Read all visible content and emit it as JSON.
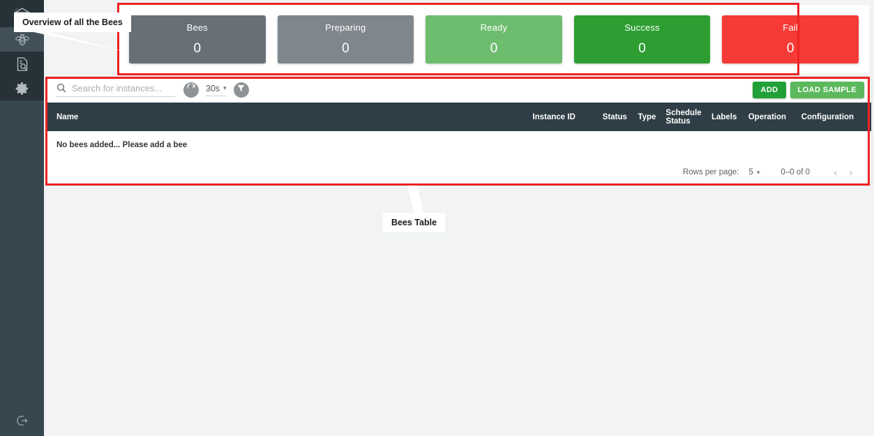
{
  "sidebar": {
    "items": [
      {
        "name": "beehive-icon",
        "label": "Beehive",
        "active": false
      },
      {
        "name": "bee-icon",
        "label": "Bees",
        "active": true
      },
      {
        "name": "document-search-icon",
        "label": "Logs",
        "active": false
      },
      {
        "name": "gear-icon",
        "label": "Settings",
        "active": false
      }
    ],
    "logout": {
      "name": "logout-icon",
      "label": "Logout"
    }
  },
  "cards": [
    {
      "label": "Bees",
      "value": "0",
      "color": "#687077"
    },
    {
      "label": "Preparing",
      "value": "0",
      "color": "#7f868c"
    },
    {
      "label": "Ready",
      "value": "0",
      "color": "#6ebd6f"
    },
    {
      "label": "Success",
      "value": "0",
      "color": "#2e9e33"
    },
    {
      "label": "Fail",
      "value": "0",
      "color": "#f63a35"
    }
  ],
  "toolbar": {
    "search_placeholder": "Search for instances...",
    "search_value": "",
    "search_icon": "search-icon",
    "refresh_icon": "refresh-icon",
    "filter_icon": "filter-icon",
    "interval_value": "30s",
    "interval_caret": "▾",
    "add_label": "ADD",
    "add_color": "#21a038",
    "load_sample_label": "LOAD SAMPLE",
    "load_sample_color": "#5cb85c"
  },
  "table": {
    "columns": [
      "Name",
      "Instance ID",
      "Status",
      "Type",
      "Schedule Status",
      "Labels",
      "Operation",
      "Configuration"
    ],
    "empty_message": "No bees added... Please add a bee",
    "rows": []
  },
  "paginator": {
    "rows_per_page_label": "Rows per page:",
    "rows_per_page_value": "5",
    "caret": "▾",
    "range": "0–0 of 0",
    "prev": "‹",
    "next": "›"
  },
  "annotations": {
    "overview_callout": "Overview of all the Bees",
    "bees_table_callout": "Bees Table",
    "highlight_color": "#ee2222"
  }
}
